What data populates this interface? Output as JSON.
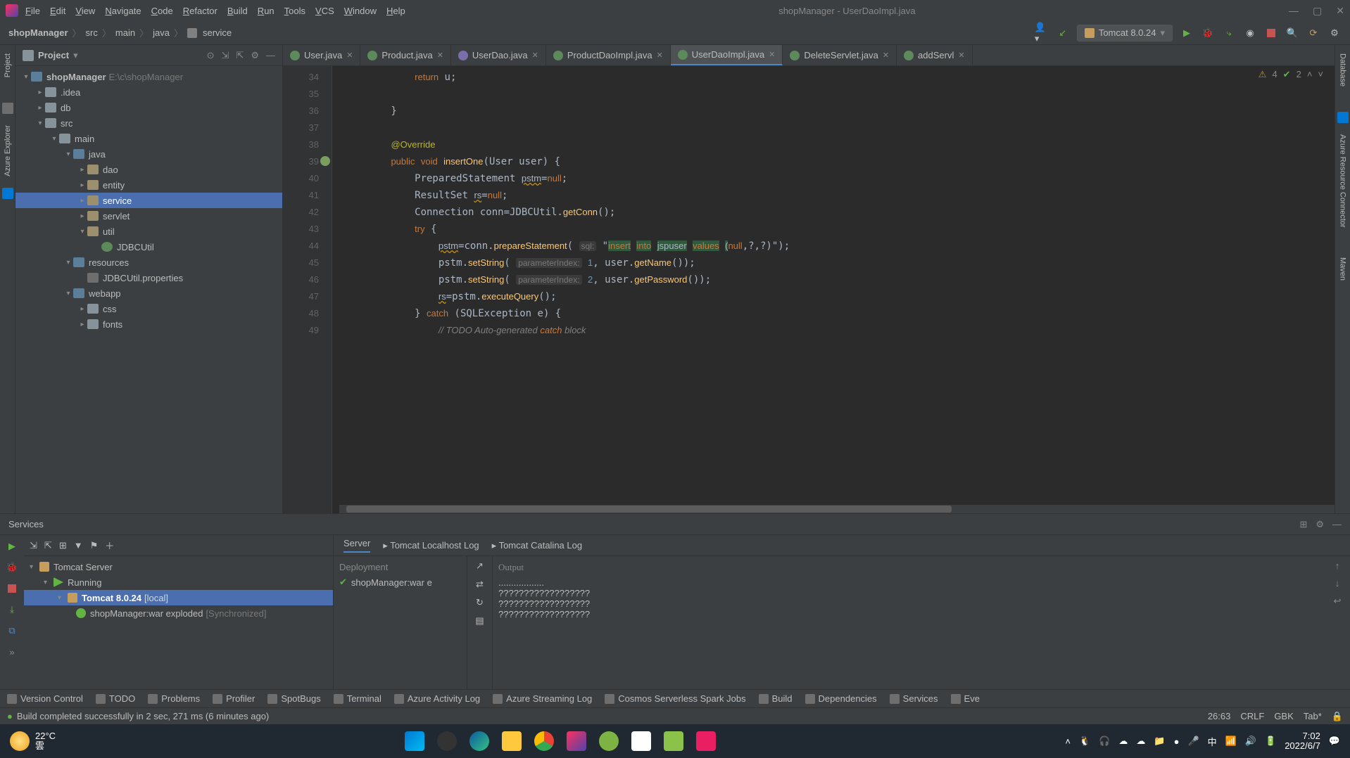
{
  "window": {
    "title": "shopManager - UserDaoImpl.java",
    "menus": [
      "File",
      "Edit",
      "View",
      "Navigate",
      "Code",
      "Refactor",
      "Build",
      "Run",
      "Tools",
      "VCS",
      "Window",
      "Help"
    ]
  },
  "breadcrumb": [
    "shopManager",
    "src",
    "main",
    "java",
    "service"
  ],
  "runConfig": "Tomcat 8.0.24",
  "project": {
    "panel_title": "Project",
    "root": {
      "name": "shopManager",
      "path": "E:\\c\\shopManager"
    },
    "nodes": [
      {
        "indent": 1,
        "name": ".idea",
        "icon": "folder",
        "arrow": "r"
      },
      {
        "indent": 1,
        "name": "db",
        "icon": "folder",
        "arrow": "r"
      },
      {
        "indent": 1,
        "name": "src",
        "icon": "folder",
        "arrow": "d"
      },
      {
        "indent": 2,
        "name": "main",
        "icon": "folder",
        "arrow": "d"
      },
      {
        "indent": 3,
        "name": "java",
        "icon": "module",
        "arrow": "d"
      },
      {
        "indent": 4,
        "name": "dao",
        "icon": "pkg",
        "arrow": "r"
      },
      {
        "indent": 4,
        "name": "entity",
        "icon": "pkg",
        "arrow": "r"
      },
      {
        "indent": 4,
        "name": "service",
        "icon": "pkg",
        "arrow": "r",
        "selected": true
      },
      {
        "indent": 4,
        "name": "servlet",
        "icon": "pkg",
        "arrow": "r"
      },
      {
        "indent": 4,
        "name": "util",
        "icon": "pkg",
        "arrow": "d"
      },
      {
        "indent": 5,
        "name": "JDBCUtil",
        "icon": "class",
        "arrow": ""
      },
      {
        "indent": 3,
        "name": "resources",
        "icon": "module",
        "arrow": "d"
      },
      {
        "indent": 4,
        "name": "JDBCUtil.properties",
        "icon": "file",
        "arrow": ""
      },
      {
        "indent": 3,
        "name": "webapp",
        "icon": "module",
        "arrow": "d"
      },
      {
        "indent": 4,
        "name": "css",
        "icon": "folder",
        "arrow": "r"
      },
      {
        "indent": 4,
        "name": "fonts",
        "icon": "folder",
        "arrow": "r"
      }
    ]
  },
  "tabs": [
    {
      "name": "User.java",
      "icon": "class"
    },
    {
      "name": "Product.java",
      "icon": "class"
    },
    {
      "name": "UserDao.java",
      "icon": "interface"
    },
    {
      "name": "ProductDaoImpl.java",
      "icon": "class"
    },
    {
      "name": "UserDaoImpl.java",
      "icon": "class",
      "active": true
    },
    {
      "name": "DeleteServlet.java",
      "icon": "class"
    },
    {
      "name": "addServl",
      "icon": "class"
    }
  ],
  "editor": {
    "startLine": 34,
    "lines": [
      "            return u;",
      "",
      "        }",
      "",
      "        @Override",
      "        public void insertOne(User user) {",
      "            PreparedStatement pstm=null;",
      "            ResultSet rs=null;",
      "            Connection conn=JDBCUtil.getConn();",
      "            try {",
      "                pstm=conn.prepareStatement( sql: \"insert into jspuser values (null,?,?)\");",
      "                pstm.setString( parameterIndex: 1, user.getName());",
      "                pstm.setString( parameterIndex: 2, user.getPassword());",
      "                rs=pstm.executeQuery();",
      "            } catch (SQLException e) {",
      "                // TODO Auto-generated catch block"
    ],
    "warnings": 4,
    "oks": 2
  },
  "services": {
    "title": "Services",
    "tree": {
      "root": "Tomcat Server",
      "running": "Running",
      "config": "Tomcat 8.0.24",
      "config_suffix": "[local]",
      "artifact": "shopManager:war exploded",
      "artifact_suffix": "[Synchronized]"
    },
    "outputTabs": [
      "Server",
      "Tomcat Localhost Log",
      "Tomcat Catalina Log"
    ],
    "deployment": {
      "header": "Deployment",
      "item": "shopManager:war e"
    },
    "output": {
      "header": "Output",
      "lines": [
        "..................",
        "??????????????????",
        "??????????????????",
        "??????????????????"
      ]
    }
  },
  "bottomStrip": [
    "Version Control",
    "TODO",
    "Problems",
    "Profiler",
    "SpotBugs",
    "Terminal",
    "Azure Activity Log",
    "Azure Streaming Log",
    "Cosmos Serverless Spark Jobs",
    "Build",
    "Dependencies",
    "Services",
    "Eve"
  ],
  "status": {
    "message": "Build completed successfully in 2 sec, 271 ms (6 minutes ago)",
    "pos": "26:63",
    "lineEnding": "CRLF",
    "encoding": "GBK",
    "indent": "Tab*"
  },
  "taskbar": {
    "temp": "22°C",
    "cond": "雲",
    "time": "7:02",
    "date": "2022/6/7"
  }
}
